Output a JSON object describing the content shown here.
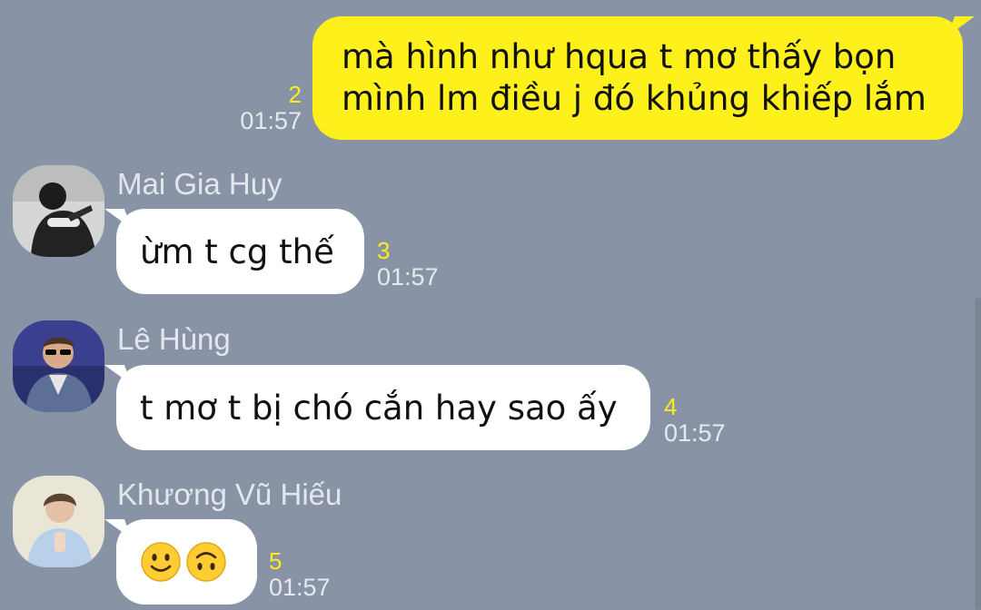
{
  "messages": [
    {
      "direction": "outgoing",
      "lines": [
        "mà hình như hqua t mơ thấy bọn",
        "mình lm điều j đó khủng khiếp lắm"
      ],
      "unread_count": "2",
      "time": "01:57"
    },
    {
      "direction": "incoming",
      "sender": "Mai Gia Huy",
      "text": "ừm t cg thế",
      "unread_count": "3",
      "time": "01:57"
    },
    {
      "direction": "incoming",
      "sender": "Lê Hùng",
      "text": "t mơ t bị chó cắn hay sao ấy",
      "unread_count": "4",
      "time": "01:57"
    },
    {
      "direction": "incoming",
      "sender": "Khương Vũ Hiếu",
      "emojis": [
        "slightly-smiling-face-icon",
        "upside-down-face-icon"
      ],
      "unread_count": "5",
      "time": "01:57"
    }
  ],
  "colors": {
    "background": "#8894a6",
    "outgoing_bubble": "#fef01b",
    "incoming_bubble": "#ffffff",
    "unread_count": "#fbec1e",
    "timestamp": "#e6e9ee",
    "sender_name": "#e3e6ec"
  }
}
